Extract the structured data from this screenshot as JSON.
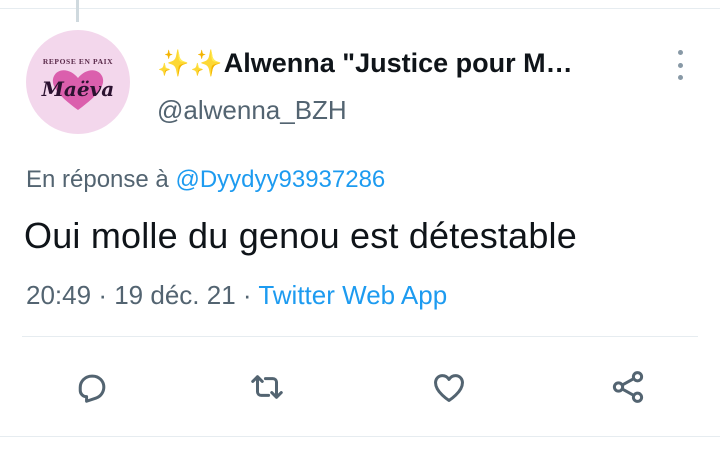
{
  "tweet": {
    "avatar": {
      "caption": "REPOSE EN PAIX",
      "name": "Maëva",
      "colors": {
        "background": "#f3d7ec",
        "heart": "#d64aa2"
      }
    },
    "display_name": "Alwenna \"Justice pour M…",
    "name_emoji": [
      "✨",
      "✨"
    ],
    "handle": "@alwenna_BZH",
    "more_icon": "more-vertical-icon",
    "reply_prefix": "En réponse à",
    "reply_mention": "@Dyydyy93937286",
    "text": "Oui molle du genou est détestable",
    "time": "20:49",
    "date": "19 déc. 21",
    "separator": "·",
    "source": "Twitter Web App"
  },
  "actions": [
    {
      "name": "reply",
      "icon": "reply-icon"
    },
    {
      "name": "retweet",
      "icon": "retweet-icon"
    },
    {
      "name": "like",
      "icon": "heart-icon"
    },
    {
      "name": "share",
      "icon": "share-icon"
    }
  ],
  "colors": {
    "text": "#0f1419",
    "secondary": "#536471",
    "link": "#1d9bf0",
    "icon": "#536471",
    "divider": "#e6ecf0"
  }
}
